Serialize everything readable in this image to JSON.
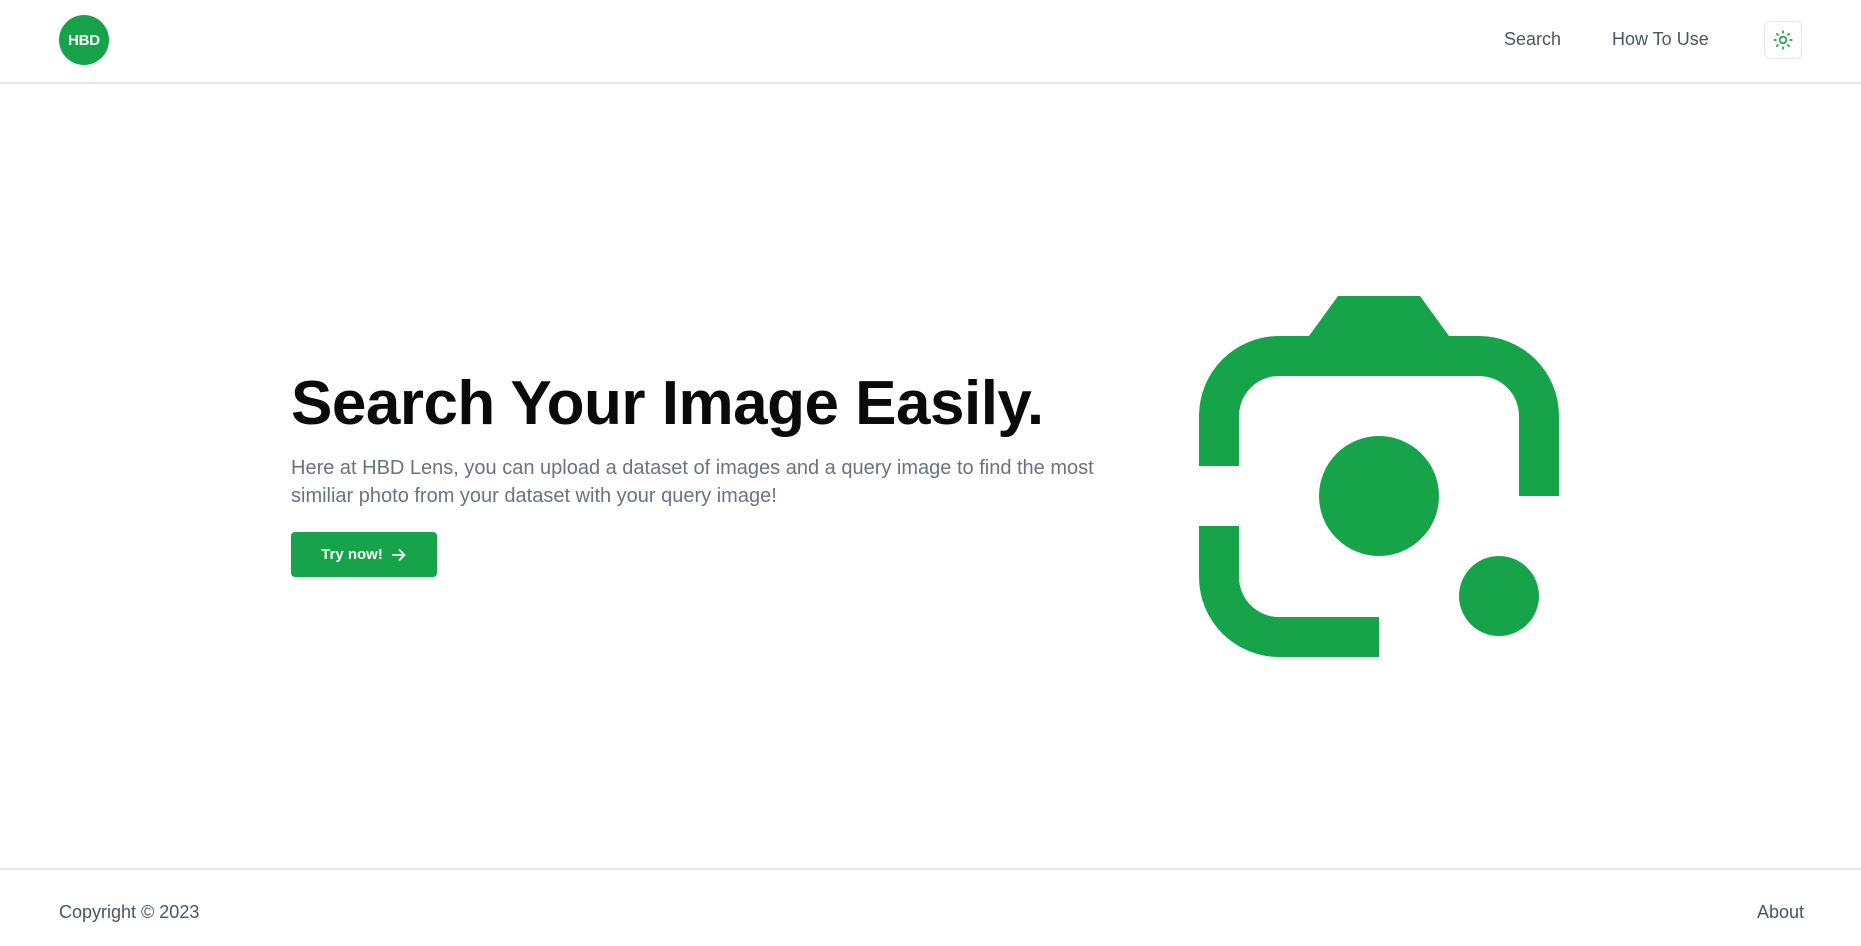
{
  "header": {
    "logo_text": "HBD",
    "nav": {
      "search": "Search",
      "how_to_use": "How To Use"
    },
    "theme_icon": "sun-icon"
  },
  "hero": {
    "title": "Search Your Image Easily.",
    "description": "Here at HBD Lens, you can upload a dataset of images and a query image to find the most similiar photo from your dataset with your query image!",
    "cta_label": "Try now!",
    "cta_icon": "arrow-right-icon",
    "graphic_icon": "lens-camera-icon"
  },
  "footer": {
    "copyright": "Copyright © 2023",
    "about": "About"
  },
  "colors": {
    "accent": "#16a34a",
    "text_muted": "#6b7280",
    "border": "#e5e7eb"
  }
}
